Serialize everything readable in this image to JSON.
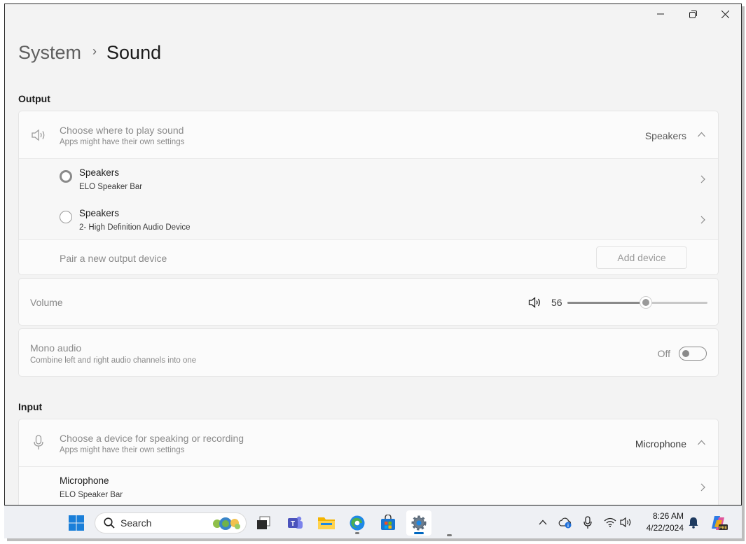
{
  "window": {
    "controls": {
      "minimize": "minimize-icon",
      "restore": "restore-icon",
      "close": "close-icon"
    }
  },
  "breadcrumb": {
    "parent": "System",
    "separator": "›",
    "current": "Sound"
  },
  "output": {
    "section_title": "Output",
    "choose": {
      "icon": "speaker-icon",
      "title": "Choose where to play sound",
      "subtitle": "Apps might have their own settings",
      "selected": "Speakers"
    },
    "devices": [
      {
        "name": "Speakers",
        "detail": "ELO Speaker Bar",
        "selected": true
      },
      {
        "name": "Speakers",
        "detail": "2- High Definition Audio Device",
        "selected": false
      }
    ],
    "pair": {
      "label": "Pair a new output device",
      "button": "Add device"
    },
    "volume": {
      "label": "Volume",
      "value": "56",
      "level": 56
    },
    "mono": {
      "title": "Mono audio",
      "subtitle": "Combine left and right audio channels into one",
      "state": "Off"
    }
  },
  "input": {
    "section_title": "Input",
    "choose": {
      "icon": "microphone-icon",
      "title": "Choose a device for speaking or recording",
      "subtitle": "Apps might have their own settings",
      "selected": "Microphone"
    },
    "devices": [
      {
        "name": "Microphone",
        "detail": "ELO Speaker Bar"
      }
    ]
  },
  "taskbar": {
    "search_placeholder": "Search",
    "time": "8:26 AM",
    "date": "4/22/2024",
    "apps": [
      "start-icon",
      "task-view-icon",
      "teams-icon",
      "file-explorer-icon",
      "edge-icon",
      "store-icon",
      "settings-icon"
    ]
  },
  "colors": {
    "window_bg": "#f3f3f3",
    "card_bg": "#fbfbfb",
    "taskbar_bg": "#eef0f4",
    "accent": "#0067c0"
  }
}
